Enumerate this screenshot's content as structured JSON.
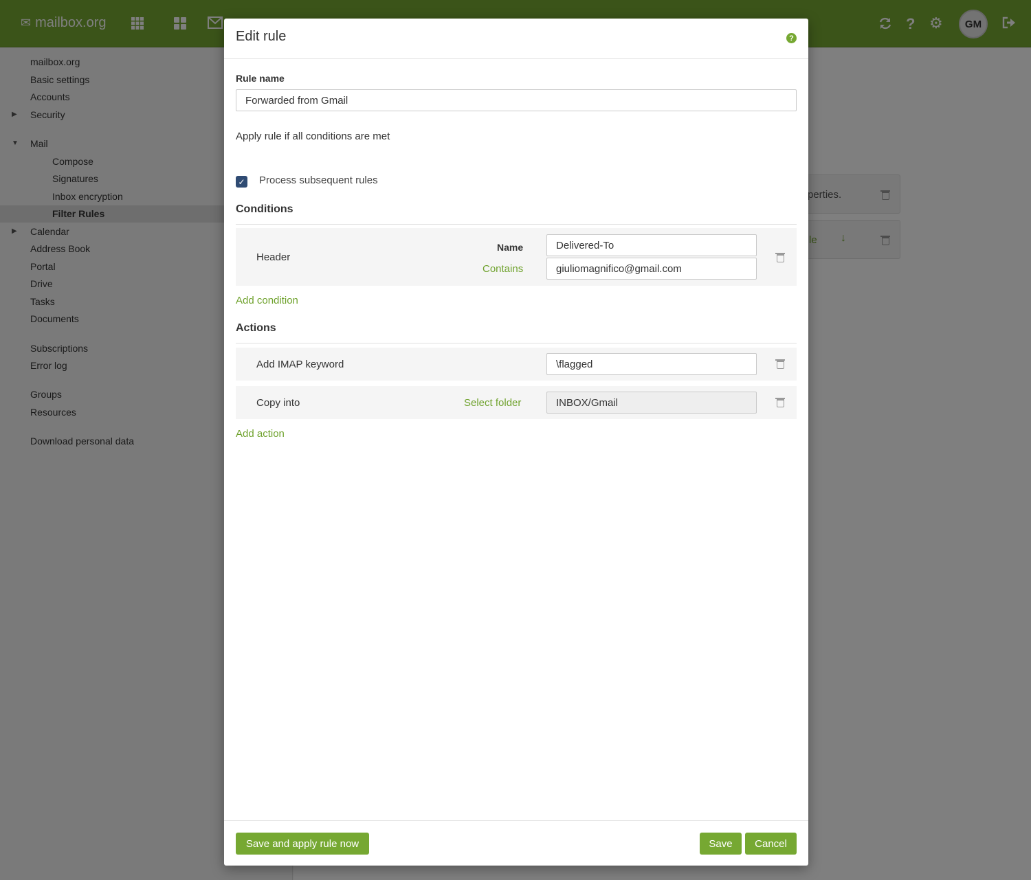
{
  "app": {
    "logo_text": "mailbox.org",
    "avatar_initials": "GM"
  },
  "sidebar": {
    "items": [
      {
        "label": "mailbox.org"
      },
      {
        "label": "Basic settings"
      },
      {
        "label": "Accounts"
      },
      {
        "label": "Security"
      },
      {
        "label": "Mail"
      },
      {
        "label": "Compose"
      },
      {
        "label": "Signatures"
      },
      {
        "label": "Inbox encryption"
      },
      {
        "label": "Filter Rules"
      },
      {
        "label": "Calendar"
      },
      {
        "label": "Address Book"
      },
      {
        "label": "Portal"
      },
      {
        "label": "Drive"
      },
      {
        "label": "Tasks"
      },
      {
        "label": "Documents"
      },
      {
        "label": "Subscriptions"
      },
      {
        "label": "Error log"
      },
      {
        "label": "Groups"
      },
      {
        "label": "Resources"
      },
      {
        "label": "Download personal data"
      }
    ]
  },
  "background": {
    "card1_text": "perties.",
    "card2_text": "le"
  },
  "modal": {
    "title": "Edit rule",
    "rule_name_label": "Rule name",
    "rule_name_value": "Forwarded from Gmail",
    "apply_text": "Apply rule if all conditions are met",
    "process_subsequent_label": "Process subsequent rules",
    "process_subsequent_checked": true,
    "conditions_heading": "Conditions",
    "condition": {
      "type": "Header",
      "name_label": "Name",
      "name_value": "Delivered-To",
      "operator": "Contains",
      "match_value": "giuliomagnifico@gmail.com"
    },
    "add_condition": "Add condition",
    "actions_heading": "Actions",
    "actions": [
      {
        "label": "Add IMAP keyword",
        "value": "\\flagged"
      },
      {
        "label": "Copy into",
        "link": "Select folder",
        "value": "INBOX/Gmail"
      }
    ],
    "add_action": "Add action",
    "footer": {
      "save_apply": "Save and apply rule now",
      "save": "Save",
      "cancel": "Cancel"
    }
  },
  "colors": {
    "brand_green": "#76a832",
    "link_green": "#6fa22d",
    "checkbox": "#2f4b73"
  }
}
